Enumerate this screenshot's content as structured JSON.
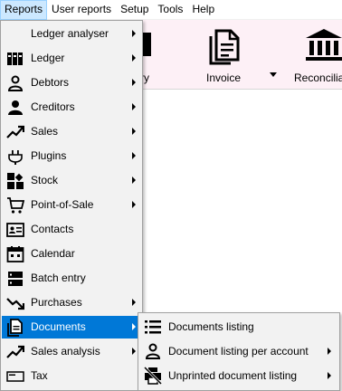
{
  "menubar": {
    "items": [
      {
        "label": "Reports"
      },
      {
        "label": "User reports"
      },
      {
        "label": "Setup"
      },
      {
        "label": "Tools"
      },
      {
        "label": "Help"
      }
    ]
  },
  "toolbar": {
    "entry_label": "ntry",
    "invoice_label": "Invoice",
    "reconcile_label": "Reconciliati"
  },
  "reports_menu": {
    "items": [
      {
        "label": "Ledger analyser",
        "icon": "none",
        "submenu": true
      },
      {
        "label": "Ledger",
        "icon": "ledger-books-icon",
        "submenu": true
      },
      {
        "label": "Debtors",
        "icon": "person-outline-icon",
        "submenu": true
      },
      {
        "label": "Creditors",
        "icon": "person-filled-icon",
        "submenu": true
      },
      {
        "label": "Sales",
        "icon": "trend-up-icon",
        "submenu": true
      },
      {
        "label": "Plugins",
        "icon": "plug-icon",
        "submenu": true
      },
      {
        "label": "Stock",
        "icon": "stock-blocks-icon",
        "submenu": true
      },
      {
        "label": "Point-of-Sale",
        "icon": "cart-icon",
        "submenu": true
      },
      {
        "label": "Contacts",
        "icon": "contact-card-icon",
        "submenu": false
      },
      {
        "label": "Calendar",
        "icon": "calendar-icon",
        "submenu": false
      },
      {
        "label": "Batch entry",
        "icon": "batch-entry-icon",
        "submenu": false
      },
      {
        "label": "Purchases",
        "icon": "trend-down-icon",
        "submenu": true
      },
      {
        "label": "Documents",
        "icon": "documents-icon",
        "submenu": true,
        "highlighted": true
      },
      {
        "label": "Sales analysis",
        "icon": "trend-up-icon",
        "submenu": true
      },
      {
        "label": "Tax",
        "icon": "tax-card-icon",
        "submenu": false
      }
    ]
  },
  "documents_submenu": {
    "items": [
      {
        "label": "Documents listing",
        "icon": "list-icon",
        "submenu": false
      },
      {
        "label": "Document listing per account",
        "icon": "person-outline-icon",
        "submenu": true
      },
      {
        "label": "Unprinted document listing",
        "icon": "printer-off-icon",
        "submenu": true
      }
    ]
  },
  "colors": {
    "highlight": "#0078d7",
    "menu_bg": "#f2f2f2",
    "ribbon_bg": "#fdf0f6",
    "active_menubar": "#cce8ff"
  }
}
